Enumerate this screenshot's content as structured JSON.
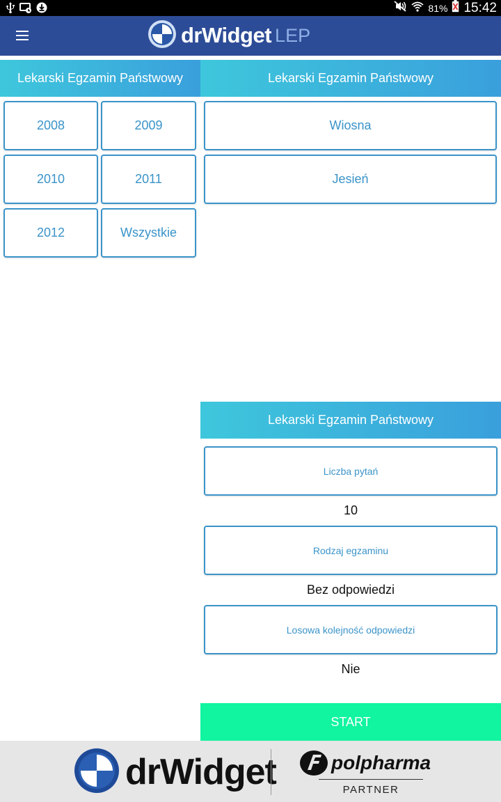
{
  "status_bar": {
    "battery": "81%",
    "time": "15:42",
    "icons": [
      "usb-icon",
      "cast-icon",
      "download-icon",
      "mute-icon",
      "wifi-icon",
      "battery-icon"
    ]
  },
  "app_bar": {
    "logo_name": "drWidget",
    "logo_suffix": "LEP",
    "icons": [
      "menu-icon",
      "drwidget-logo-icon"
    ]
  },
  "years_panel": {
    "header": "Lekarski Egzamin Państwowy",
    "items": [
      "2008",
      "2009",
      "2010",
      "2011",
      "2012",
      "Wszystkie"
    ]
  },
  "session_panel": {
    "header": "Lekarski Egzamin Państwowy",
    "items": [
      "Wiosna",
      "Jesień"
    ]
  },
  "settings_panel": {
    "header": "Lekarski Egzamin Państwowy",
    "questions_label": "Liczba pytań",
    "questions_value": "10",
    "exam_type_label": "Rodzaj egzaminu",
    "exam_type_value": "Bez odpowiedzi",
    "shuffle_label": "Losowa kolejność odpowiedzi",
    "shuffle_value": "Nie",
    "start_label": "START"
  },
  "footer": {
    "brand_name": "drWidget",
    "partner_name": "polpharma",
    "partner_label": "PARTNER"
  },
  "colors": {
    "app_bar": "#2d4c97",
    "accent": "#3a93c9",
    "header_start": "#3ec7dc",
    "header_end": "#3a9fdc",
    "start_button": "#11f4a0"
  }
}
